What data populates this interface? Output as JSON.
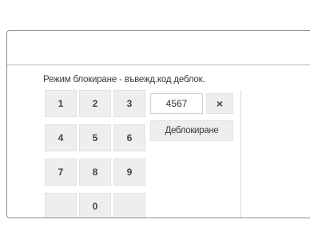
{
  "dialog": {
    "title": "Режим блокиране - въвежд.код деблок."
  },
  "keypad": {
    "keys": [
      "1",
      "2",
      "3",
      "4",
      "5",
      "6",
      "7",
      "8",
      "9",
      "",
      "0",
      ""
    ]
  },
  "code": {
    "value": "4567"
  },
  "buttons": {
    "clear_label": "×",
    "unlock_label": "Деблокиране"
  }
}
